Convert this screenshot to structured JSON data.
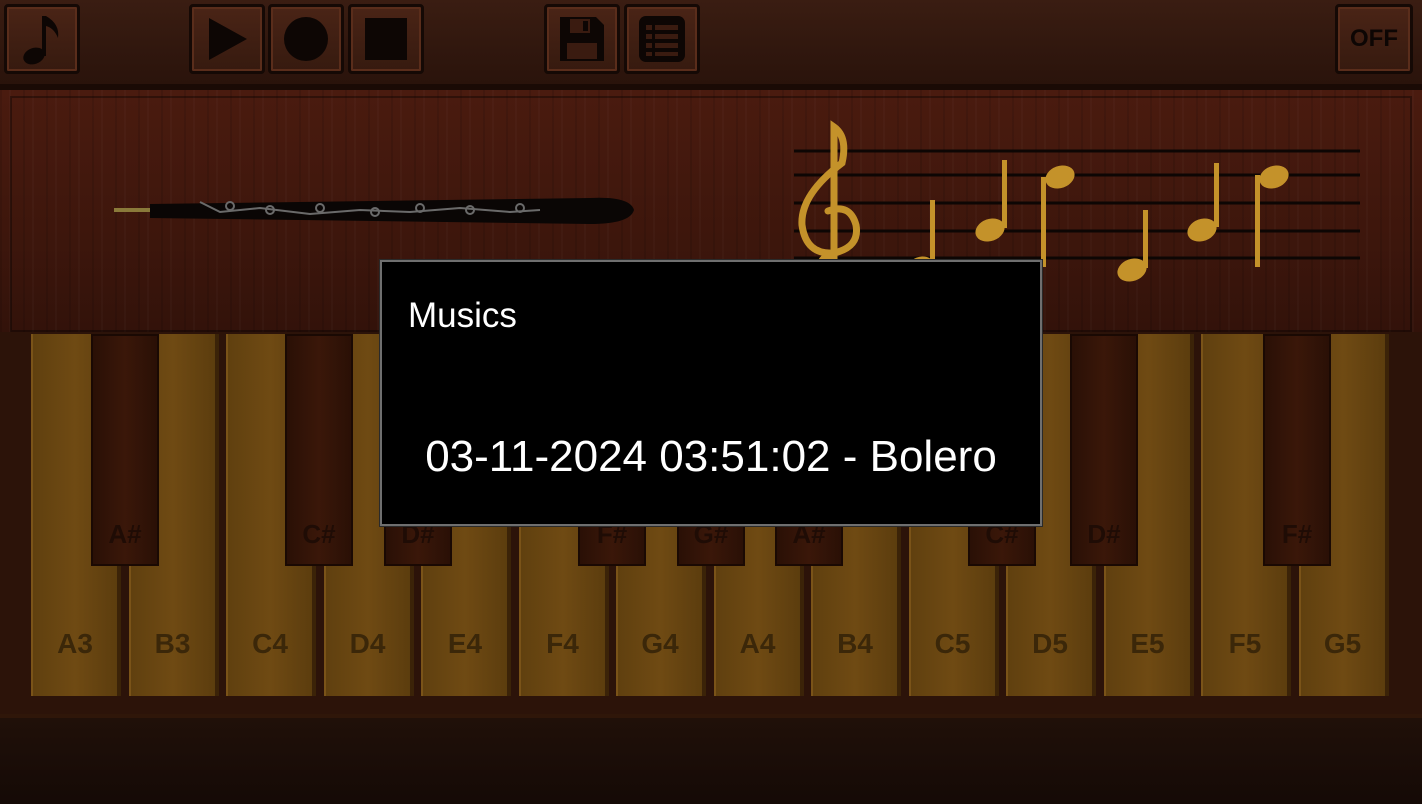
{
  "toolbar": {
    "buttons": [
      {
        "name": "music-note-button",
        "icon": "music-note-icon"
      },
      {
        "name": "play-button",
        "icon": "play-icon"
      },
      {
        "name": "record-button",
        "icon": "record-icon"
      },
      {
        "name": "stop-button",
        "icon": "stop-icon"
      },
      {
        "name": "save-button",
        "icon": "floppy-disk-icon"
      },
      {
        "name": "list-button",
        "icon": "list-icon"
      }
    ],
    "off_label": "OFF"
  },
  "instrument": {
    "icon": "oboe-icon"
  },
  "staff": {
    "icon": "treble-clef-icon"
  },
  "keyboard": {
    "white_keys": [
      "A3",
      "B3",
      "C4",
      "D4",
      "E4",
      "F4",
      "G4",
      "A4",
      "B4",
      "C5",
      "D5",
      "E5",
      "F5",
      "G5"
    ],
    "black_keys": [
      "A#",
      "C#",
      "D#",
      "F#",
      "G#",
      "A#",
      "C#",
      "D#",
      "F#"
    ]
  },
  "dialog": {
    "title": "Musics",
    "items": [
      "03-11-2024 03:51:02 - Bolero"
    ]
  },
  "colors": {
    "wood": "#3d160c",
    "key": "#6f4a13",
    "gold": "#d4a02a",
    "dialog_bg": "#000000"
  }
}
